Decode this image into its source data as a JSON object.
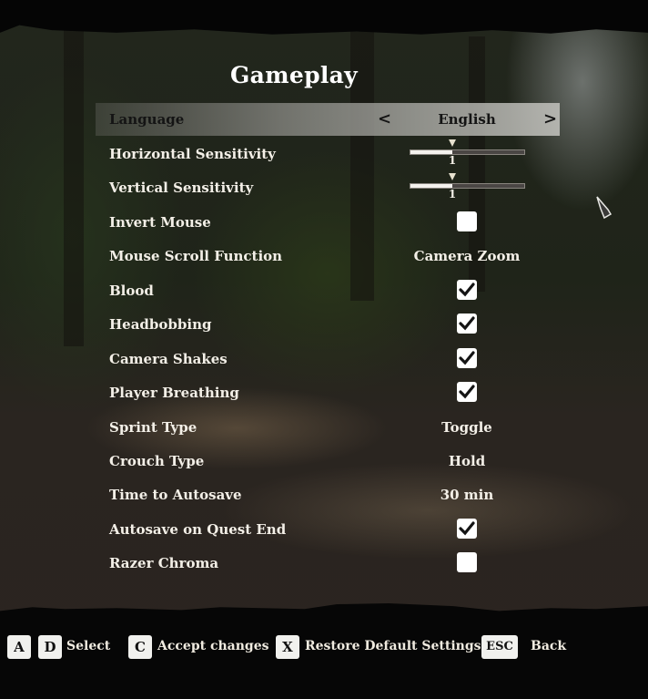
{
  "title": "Gameplay",
  "settings": {
    "language": {
      "label": "Language",
      "value": "English",
      "prev": "<",
      "next": ">"
    },
    "horizontal_sensitivity": {
      "label": "Horizontal Sensitivity",
      "value": "1",
      "fraction": 0.37
    },
    "vertical_sensitivity": {
      "label": "Vertical Sensitivity",
      "value": "1",
      "fraction": 0.37
    },
    "invert_mouse": {
      "label": "Invert Mouse",
      "checked": false
    },
    "mouse_scroll_function": {
      "label": "Mouse Scroll Function",
      "value": "Camera Zoom"
    },
    "blood": {
      "label": "Blood",
      "checked": true
    },
    "headbobbing": {
      "label": "Headbobbing",
      "checked": true
    },
    "camera_shakes": {
      "label": "Camera Shakes",
      "checked": true
    },
    "player_breathing": {
      "label": "Player Breathing",
      "checked": true
    },
    "sprint_type": {
      "label": "Sprint Type",
      "value": "Toggle"
    },
    "crouch_type": {
      "label": "Crouch Type",
      "value": "Hold"
    },
    "time_to_autosave": {
      "label": "Time to Autosave",
      "value": "30 min"
    },
    "autosave_on_quest_end": {
      "label": "Autosave on Quest End",
      "checked": true
    },
    "razer_chroma": {
      "label": "Razer Chroma",
      "checked": false
    }
  },
  "footer": {
    "select": {
      "keys": [
        "A",
        "D"
      ],
      "label": "Select"
    },
    "accept": {
      "key": "C",
      "label": "Accept changes"
    },
    "restore": {
      "key": "X",
      "label": "Restore Default Settings"
    },
    "back": {
      "key": "ESC",
      "label": "Back"
    }
  },
  "icons": {
    "checkmark": "check-icon",
    "cursor": "pointer-cursor-icon"
  }
}
